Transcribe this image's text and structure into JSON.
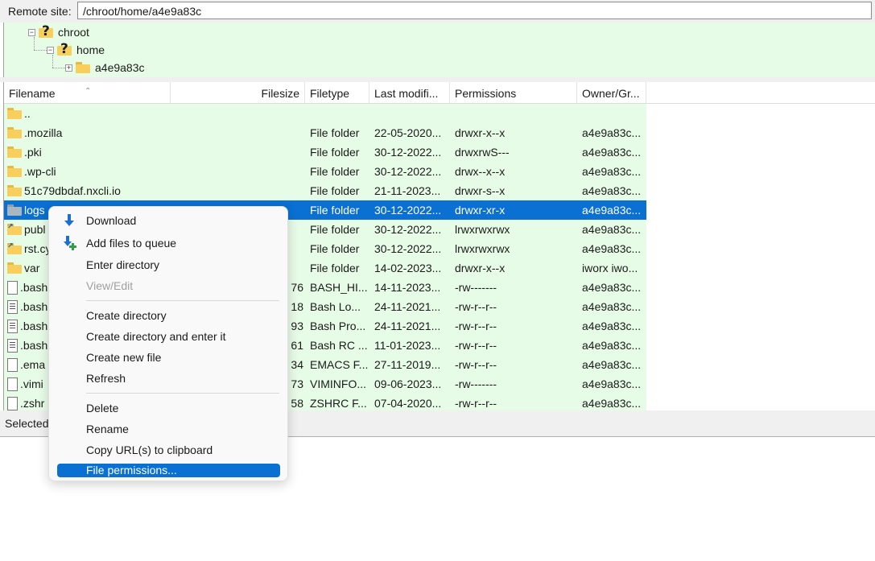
{
  "remote": {
    "label": "Remote site:",
    "path": "/chroot/home/a4e9a83c"
  },
  "tree": [
    {
      "name": "chroot",
      "expander": "−"
    },
    {
      "name": "home",
      "expander": "−"
    },
    {
      "name": "a4e9a83c",
      "expander": "+"
    }
  ],
  "columns": {
    "filename": "Filename",
    "filesize": "Filesize",
    "filetype": "Filetype",
    "modified": "Last modifi...",
    "permissions": "Permissions",
    "owner": "Owner/Gr..."
  },
  "files": [
    {
      "name": "..",
      "size": "",
      "type": "",
      "modified": "",
      "perms": "",
      "owner": "",
      "icon": "folder"
    },
    {
      "name": ".mozilla",
      "size": "",
      "type": "File folder",
      "modified": "22-05-2020...",
      "perms": "drwxr-x--x",
      "owner": "a4e9a83c...",
      "icon": "folder"
    },
    {
      "name": ".pki",
      "size": "",
      "type": "File folder",
      "modified": "30-12-2022...",
      "perms": "drwxrwS---",
      "owner": "a4e9a83c...",
      "icon": "folder"
    },
    {
      "name": ".wp-cli",
      "size": "",
      "type": "File folder",
      "modified": "30-12-2022...",
      "perms": "drwx--x--x",
      "owner": "a4e9a83c...",
      "icon": "folder"
    },
    {
      "name": "51c79dbdaf.nxcli.io",
      "size": "",
      "type": "File folder",
      "modified": "21-11-2023...",
      "perms": "drwxr-s--x",
      "owner": "a4e9a83c...",
      "icon": "folder"
    },
    {
      "name": "logs",
      "size": "",
      "type": "File folder",
      "modified": "30-12-2022...",
      "perms": "drwxr-xr-x",
      "owner": "a4e9a83c...",
      "icon": "folder-grey",
      "selected": true
    },
    {
      "name": "publ",
      "size": "",
      "type": "File folder",
      "modified": "30-12-2022...",
      "perms": "lrwxrwxrwx",
      "owner": "a4e9a83c...",
      "icon": "folder-link"
    },
    {
      "name": "rst.cy",
      "size": "",
      "type": "File folder",
      "modified": "30-12-2022...",
      "perms": "lrwxrwxrwx",
      "owner": "a4e9a83c...",
      "icon": "folder-link"
    },
    {
      "name": "var",
      "size": "",
      "type": "File folder",
      "modified": "14-02-2023...",
      "perms": "drwxr-x--x",
      "owner": "iworx iwo...",
      "icon": "folder"
    },
    {
      "name": ".bash",
      "size": "76",
      "type": "BASH_HI...",
      "modified": "14-11-2023...",
      "perms": "-rw-------",
      "owner": "a4e9a83c...",
      "icon": "file"
    },
    {
      "name": ".bash",
      "size": "18",
      "type": "Bash Lo...",
      "modified": "24-11-2021...",
      "perms": "-rw-r--r--",
      "owner": "a4e9a83c...",
      "icon": "file-dark"
    },
    {
      "name": ".bash",
      "size": "93",
      "type": "Bash Pro...",
      "modified": "24-11-2021...",
      "perms": "-rw-r--r--",
      "owner": "a4e9a83c...",
      "icon": "file-dark"
    },
    {
      "name": ".bash",
      "size": "61",
      "type": "Bash RC ...",
      "modified": "11-01-2023...",
      "perms": "-rw-r--r--",
      "owner": "a4e9a83c...",
      "icon": "file-dark"
    },
    {
      "name": ".ema",
      "size": "34",
      "type": "EMACS F...",
      "modified": "27-11-2019...",
      "perms": "-rw-r--r--",
      "owner": "a4e9a83c...",
      "icon": "file"
    },
    {
      "name": ".vimi",
      "size": "73",
      "type": "VIMINFO...",
      "modified": "09-06-2023...",
      "perms": "-rw-------",
      "owner": "a4e9a83c...",
      "icon": "file"
    },
    {
      "name": ".zshr",
      "size": "58",
      "type": "ZSHRC F...",
      "modified": "07-04-2020...",
      "perms": "-rw-r--r--",
      "owner": "a4e9a83c...",
      "icon": "file"
    }
  ],
  "status": {
    "text": "Selected"
  },
  "menu": {
    "download": "Download",
    "add_queue": "Add files to queue",
    "enter_dir": "Enter directory",
    "view_edit": "View/Edit",
    "create_dir": "Create directory",
    "create_dir_enter": "Create directory and enter it",
    "create_file": "Create new file",
    "refresh": "Refresh",
    "delete": "Delete",
    "rename": "Rename",
    "copy_url": "Copy URL(s) to clipboard",
    "file_perms": "File permissions..."
  },
  "colors": {
    "list_bg": "#e7fce7",
    "selection": "#0a70d2",
    "folder": "#f8cf5c"
  }
}
